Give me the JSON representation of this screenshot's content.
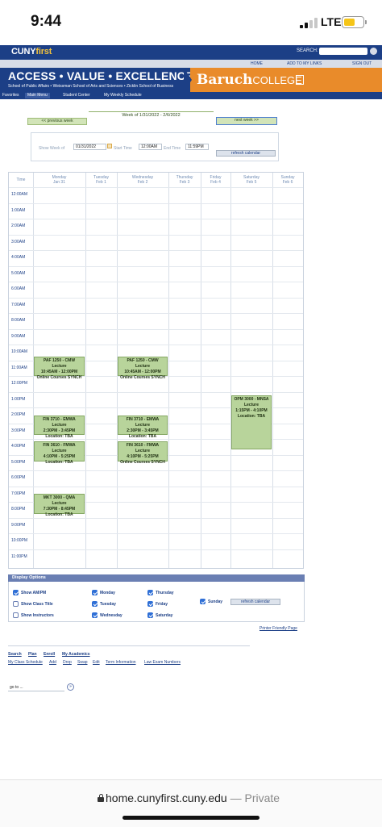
{
  "status_bar": {
    "time": "9:44",
    "network": "LTE"
  },
  "header": {
    "logo_cuny": "CUNY",
    "logo_first": "first",
    "search_label": "SEARCH:",
    "top_links": [
      "HOME",
      "ADD TO MY LINKS",
      "SIGN OUT"
    ],
    "tagline": "ACCESS • VALUE • EXCELLENCE",
    "schools": "School of Public Affairs • Weissman School of Arts and Sciences • Zicklin School of Business",
    "college_main": "Baruch",
    "college_sub": "COLLEGE",
    "nav": [
      "Favorites",
      "Main Menu",
      "Student Center",
      "My Weekly Schedule"
    ]
  },
  "week": {
    "label": "Week of 1/31/2022 - 2/6/2022",
    "prev": "<< previous week",
    "next": "next week >>"
  },
  "filters": {
    "show_week_of_label": "Show Week of",
    "show_week_of": "01/31/2022",
    "start_time_label": "Start Time",
    "start_time": "12:00AM",
    "end_time_label": "End Time",
    "end_time": "11:59PM",
    "refresh": "refresh calendar"
  },
  "grid": {
    "time_header": "Time",
    "days": [
      {
        "name": "Monday",
        "date": "Jan 31"
      },
      {
        "name": "Tuesday",
        "date": "Feb 1"
      },
      {
        "name": "Wednesday",
        "date": "Feb 2"
      },
      {
        "name": "Thursday",
        "date": "Feb 3"
      },
      {
        "name": "Friday",
        "date": "Feb 4"
      },
      {
        "name": "Saturday",
        "date": "Feb 5"
      },
      {
        "name": "Sunday",
        "date": "Feb 6"
      }
    ],
    "times": [
      "12:00AM",
      "1:00AM",
      "2:00AM",
      "3:00AM",
      "4:00AM",
      "5:00AM",
      "6:00AM",
      "7:00AM",
      "8:00AM",
      "9:00AM",
      "10:00AM",
      "11:00AM",
      "12:00PM",
      "1:00PM",
      "2:00PM",
      "3:00PM",
      "4:00PM",
      "5:00PM",
      "6:00PM",
      "7:00PM",
      "8:00PM",
      "9:00PM",
      "10:00PM",
      "11:00PM"
    ],
    "events": [
      {
        "day": 0,
        "start": 10.75,
        "end": 12.0,
        "lines": [
          "PAF 1250 - CMW",
          "Lecture",
          "10:45AM - 12:00PM",
          "Online Courses SYNCH"
        ]
      },
      {
        "day": 2,
        "start": 10.75,
        "end": 12.0,
        "lines": [
          "PAF 1250 - CMW",
          "Lecture",
          "10:45AM - 12:00PM",
          "Online Courses SYNCH"
        ]
      },
      {
        "day": 0,
        "start": 14.5,
        "end": 15.75,
        "lines": [
          "FIN 3710 - EMWA",
          "Lecture",
          "2:30PM - 3:45PM",
          "Location: TBA"
        ]
      },
      {
        "day": 2,
        "start": 14.5,
        "end": 15.75,
        "lines": [
          "FIN 3710 - EMWA",
          "Lecture",
          "2:30PM - 3:45PM",
          "Location: TBA"
        ]
      },
      {
        "day": 0,
        "start": 16.17,
        "end": 17.42,
        "lines": [
          "FIN 3610 - FMWA",
          "Lecture",
          "4:10PM - 5:25PM",
          "Location: TBA"
        ]
      },
      {
        "day": 2,
        "start": 16.17,
        "end": 17.42,
        "lines": [
          "FIN 3610 - FMWA",
          "Lecture",
          "4:10PM - 5:25PM",
          "Online Courses SYNCH"
        ]
      },
      {
        "day": 5,
        "start": 13.25,
        "end": 16.67,
        "lines": [
          "OPM 3000 - MNSA",
          "Lecture",
          "1:15PM - 4:10PM",
          "Location: TBA"
        ]
      },
      {
        "day": 0,
        "start": 19.5,
        "end": 20.75,
        "lines": [
          "MKT 3000 - QMA",
          "Lecture",
          "7:30PM - 8:45PM",
          "Location: TBA"
        ]
      }
    ]
  },
  "display_options": {
    "title": "Display Options",
    "options": [
      {
        "label": "Show AM/PM",
        "checked": true
      },
      {
        "label": "Show Class Title",
        "checked": false
      },
      {
        "label": "Show Instructors",
        "checked": false
      },
      {
        "label": "Monday",
        "checked": true
      },
      {
        "label": "Tuesday",
        "checked": true
      },
      {
        "label": "Wednesday",
        "checked": true
      },
      {
        "label": "Thursday",
        "checked": true
      },
      {
        "label": "Friday",
        "checked": true
      },
      {
        "label": "Saturday",
        "checked": true
      },
      {
        "label": "Sunday",
        "checked": true
      }
    ],
    "refresh": "refresh calendar"
  },
  "printer_link": "Printer Friendly Page",
  "footer": {
    "primary": [
      "Search",
      "Plan",
      "Enroll",
      "My Academics"
    ],
    "secondary": [
      "My Class Schedule",
      "Add",
      "Drop",
      "Swap",
      "Edit",
      "Term Information",
      "Law Exam Numbers"
    ],
    "goto": "go to ..."
  },
  "browser": {
    "domain": "home.cunyfirst.cuny.edu",
    "private": "— Private"
  },
  "colors": {
    "navy": "#1c3f86",
    "orange": "#e98b2a",
    "event_green": "#b8d49b",
    "checkbox_blue": "#2f6fd6"
  }
}
